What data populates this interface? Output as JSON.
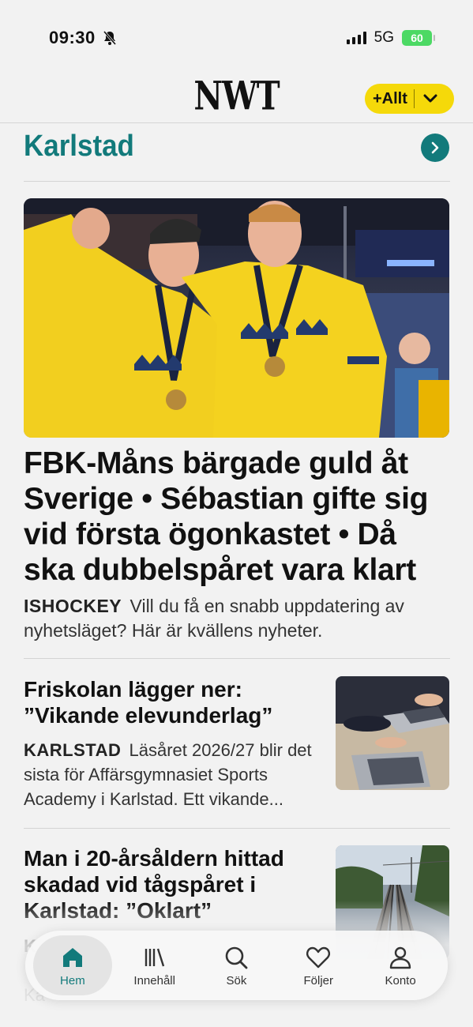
{
  "status_bar": {
    "time": "09:30",
    "network": "5G",
    "battery": "60"
  },
  "header": {
    "logo": "NWT",
    "allt_label": "+Allt"
  },
  "section": {
    "title": "Karlstad"
  },
  "hero": {
    "title": "FBK-Måns bärgade guld åt Sverige • Sébastian gifte sig vid första ögonkastet • Då ska dubbelspåret vara klart",
    "kicker": "ISHOCKEY",
    "lead": "Vill du få en snabb uppdatering av nyhetsläget? Här är kvällens nyheter."
  },
  "articles": [
    {
      "title": "Friskolan lägger ner: ”Vikande elevunderlag”",
      "kicker": "KARLSTAD",
      "lead": "Läsåret 2026/27 blir det sista för Affärsgymnasiet Sports Academy i Karlstad. Ett vikande..."
    },
    {
      "title": "Man i 20-årsåldern hittad skadad vid tågspåret i Karlstad: ”Oklart”",
      "kicker": "K",
      "lead": "Ka"
    }
  ],
  "tabbar": {
    "items": [
      {
        "label": "Hem",
        "icon": "home-icon"
      },
      {
        "label": "Innehåll",
        "icon": "library-icon"
      },
      {
        "label": "Sök",
        "icon": "search-icon"
      },
      {
        "label": "Följer",
        "icon": "heart-icon"
      },
      {
        "label": "Konto",
        "icon": "account-icon"
      }
    ]
  },
  "colors": {
    "accent": "#127a7b",
    "allt_yellow": "#f5d90a",
    "battery_green": "#4cd964"
  }
}
